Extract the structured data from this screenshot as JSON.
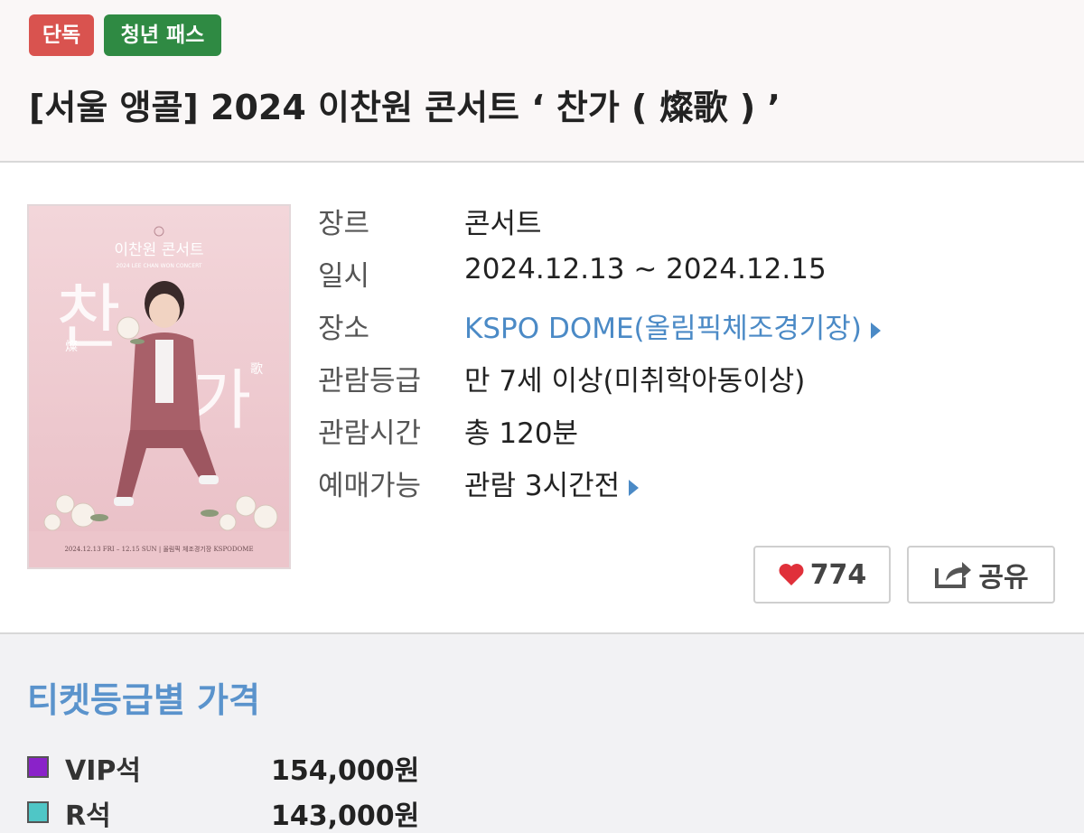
{
  "header": {
    "badges": [
      "단독",
      "청년 패스"
    ],
    "title": "[서울 앵콜] 2024 이찬원 콘서트 ‘ 찬가 ( 燦歌 ) ’",
    "colors": {
      "badge_exclusive": "#d9534f",
      "badge_youth": "#2f8a43"
    }
  },
  "poster": {
    "top_text": "이찬원 콘서트",
    "sub_text": "2024 LEE CHAN WON CONCERT",
    "big_char_1": "찬",
    "big_char_2": "가",
    "hanja_1": "燦",
    "hanja_2": "歌",
    "footer_text": "2024.12.13 FRI – 12.15 SUN | 올림픽 체조경기장 KSPODOME"
  },
  "info": {
    "genre": {
      "label": "장르",
      "value": "콘서트"
    },
    "date": {
      "label": "일시",
      "value": "2024.12.13 ~ 2024.12.15"
    },
    "venue": {
      "label": "장소",
      "value": "KSPO DOME(올림픽체조경기장)",
      "icon": "triangle-right-icon"
    },
    "rating": {
      "label": "관람등급",
      "value": "만 7세 이상(미취학아동이상)"
    },
    "runtime": {
      "label": "관람시간",
      "value": "총 120분"
    },
    "booking": {
      "label": "예매가능",
      "value": "관람 3시간전",
      "icon": "triangle-right-icon"
    }
  },
  "actions": {
    "like_count": "774",
    "like_icon": "heart-icon",
    "share_label": "공유",
    "share_icon": "share-icon",
    "colors": {
      "heart": "#e0303a"
    }
  },
  "prices": {
    "heading": "티켓등급별 가격",
    "rows": [
      {
        "grade": "VIP석",
        "price": "154,000원",
        "color": "#8a22c9"
      },
      {
        "grade": "R석",
        "price": "143,000원",
        "color": "#4fc6c6"
      }
    ],
    "colors": {
      "heading": "#5a93cc"
    }
  }
}
